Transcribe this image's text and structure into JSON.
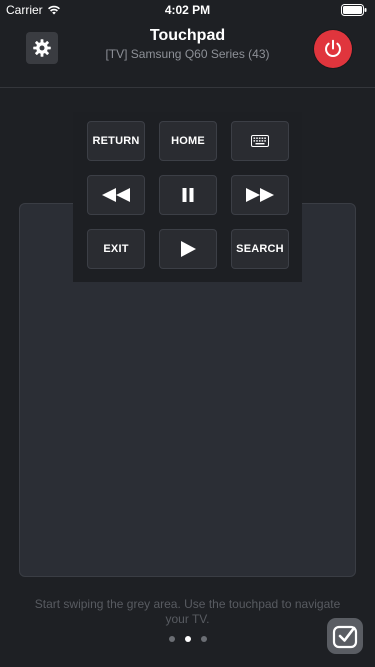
{
  "status_bar": {
    "carrier": "Carrier",
    "time": "4:02 PM"
  },
  "header": {
    "title": "Touchpad",
    "subtitle": "[TV] Samsung Q60 Series (43)",
    "settings_icon": "gear-icon",
    "power_icon": "power-icon",
    "power_color": "#e0353d"
  },
  "controls": {
    "return_label": "RETURN",
    "home_label": "HOME",
    "keyboard_icon": "keyboard-icon",
    "rewind_icon": "rewind-icon",
    "pause_icon": "pause-icon",
    "fast_forward_icon": "fast-forward-icon",
    "exit_label": "EXIT",
    "play_icon": "play-icon",
    "search_label": "SEARCH"
  },
  "touchpad": {
    "hint": "Start swiping the grey area. Use the touchpad to navigate your TV."
  },
  "pager": {
    "pages": 3,
    "active_page": 2
  }
}
